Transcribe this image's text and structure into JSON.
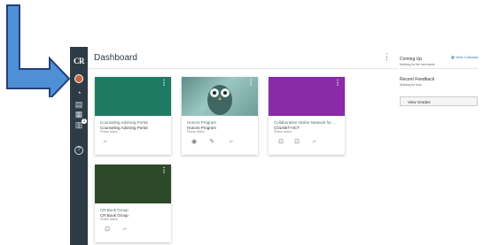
{
  "app": {
    "logo": "CR",
    "title": "Dashboard",
    "kebab": "⋮"
  },
  "nav": [
    {
      "name": "avatar"
    },
    {
      "name": "dashboard-icon",
      "glyph": "◔"
    },
    {
      "name": "courses-icon",
      "glyph": "▤"
    },
    {
      "name": "calendar-icon",
      "glyph": "▦"
    },
    {
      "name": "inbox-icon",
      "glyph": "▥",
      "badge": "1"
    },
    {
      "name": "help-icon",
      "glyph": "?"
    }
  ],
  "cards": [
    {
      "name": "Counseling Advising Portal",
      "code": "Counseling Advising Portal",
      "term": "Phase slides",
      "color": "#1f7a63",
      "menu": "⋮"
    },
    {
      "name": "Honors Program",
      "code": "Honors Program",
      "term": "Phase slides",
      "color": "#7aa9a4",
      "menu": "⋮"
    },
    {
      "name": "Collaborative Online Network for ...",
      "code": "COLNET-HCT",
      "term": "Phase slides",
      "color": "#8a2aa6",
      "menu": "⋮"
    },
    {
      "name": "CR Book Group",
      "code": "CR Book Group",
      "term": "Phase slides",
      "color": "#2c4a2a",
      "menu": "⋮"
    }
  ],
  "sidebar": {
    "coming_up": "Coming Up",
    "view_calendar": "View Calendar",
    "nothing": "Nothing for the next week",
    "recent_feedback": "Recent Feedback",
    "nothing_feedback": "Nothing for now",
    "view_grades": "View Grades"
  }
}
